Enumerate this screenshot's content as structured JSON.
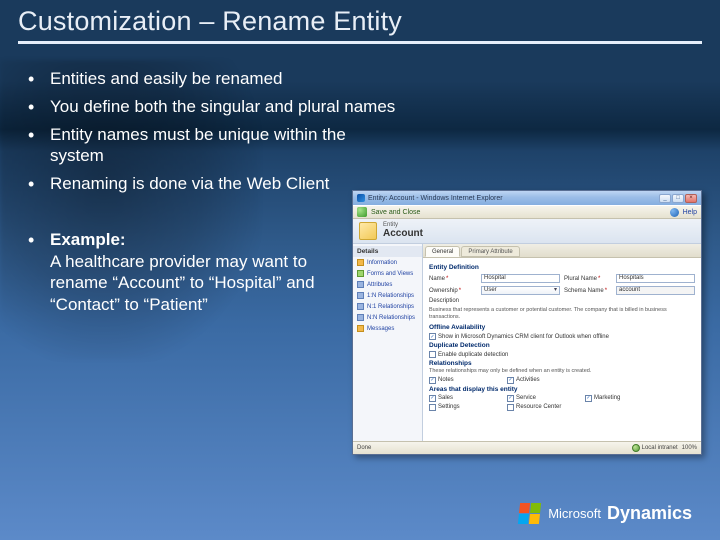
{
  "title": "Customization – Rename Entity",
  "bullets": {
    "b1": "Entities and easily be renamed",
    "b2": "You define both the singular and plural names",
    "b3": "Entity names must be unique within the system",
    "b4": "Renaming is done via the Web Client",
    "b5_label": "Example:",
    "b5_body": "A healthcare provider may want to rename “Account” to “Hospital” and “Contact” to “Patient”"
  },
  "ie": {
    "window_title": "Entity: Account - Windows Internet Explorer",
    "toolbar": {
      "save_close": "Save and Close",
      "help": "Help"
    },
    "header": {
      "kicker": "Entity",
      "name": "Account"
    },
    "sidebar": {
      "heading": "Details",
      "items": [
        "Information",
        "Forms and Views",
        "Attributes",
        "1:N Relationships",
        "N:1 Relationships",
        "N:N Relationships",
        "Messages"
      ]
    },
    "tabs": {
      "general": "General",
      "primary": "Primary Attribute"
    },
    "form": {
      "section_def": "Entity Definition",
      "name_lbl": "Name",
      "name_val": "Hospital",
      "plural_lbl": "Plural Name",
      "plural_val": "Hospitals",
      "ownership_lbl": "Ownership",
      "ownership_val": "User",
      "schema_lbl": "Schema Name",
      "schema_val": "account",
      "desc_lbl": "Description",
      "desc_val": "Business that represents a customer or potential customer. The company that is billed in business transactions.",
      "section_offline": "Offline Availability",
      "offline_opt": "Show in Microsoft Dynamics CRM client for Outlook when offline",
      "section_dup": "Duplicate Detection",
      "dup_opt": "Enable duplicate detection",
      "section_rel": "Relationships",
      "rel_note": "These relationships may only be defined when an entity is created.",
      "rel_notes": "Notes",
      "rel_activities": "Activities",
      "section_areas": "Areas that display this entity",
      "area_sales": "Sales",
      "area_service": "Service",
      "area_marketing": "Marketing",
      "area_settings": "Settings",
      "area_rc": "Resource Center"
    },
    "status": {
      "done": "Done",
      "zone": "Local intranet",
      "zoom": "100%"
    }
  },
  "brand": {
    "w1": "Microsoft",
    "w2": "Dynamics"
  }
}
